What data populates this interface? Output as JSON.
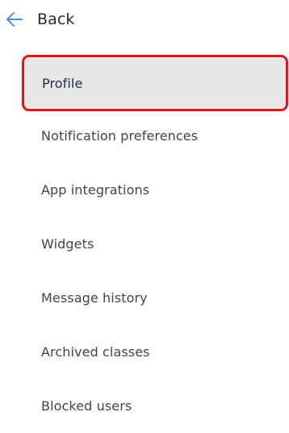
{
  "header": {
    "back_label": "Back",
    "back_icon": "arrow-left-icon",
    "accent_color": "#4a90e2"
  },
  "menu": {
    "active_index": 0,
    "highlight_color": "#e0141c",
    "items": [
      {
        "label": "Profile"
      },
      {
        "label": "Notification preferences"
      },
      {
        "label": "App integrations"
      },
      {
        "label": "Widgets"
      },
      {
        "label": "Message history"
      },
      {
        "label": "Archived classes"
      },
      {
        "label": "Blocked users"
      }
    ]
  }
}
